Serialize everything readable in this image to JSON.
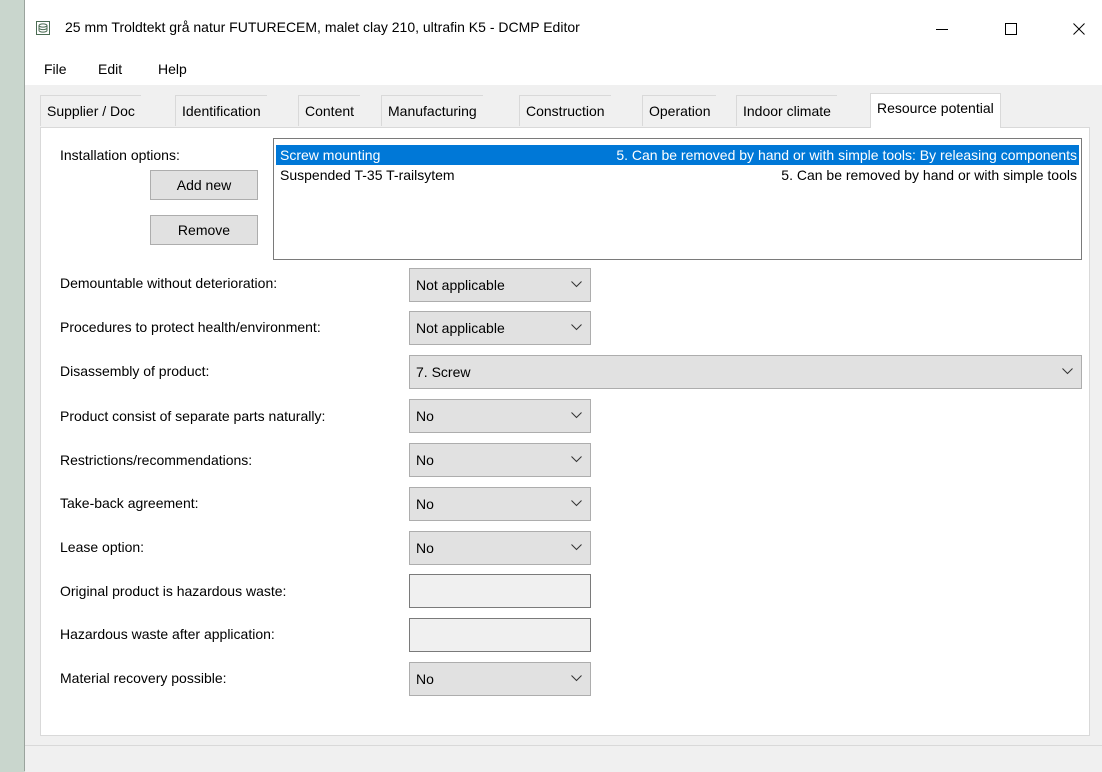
{
  "window": {
    "title": "25 mm Troldtekt grå natur FUTURECEM, malet clay  210, ultrafin K5 - DCMP Editor",
    "app_icon": "db-icon"
  },
  "menu": [
    "File",
    "Edit",
    "Help"
  ],
  "tabs": [
    {
      "label": "Supplier / Doc",
      "active": false
    },
    {
      "label": "Identification",
      "active": false
    },
    {
      "label": "Content",
      "active": false
    },
    {
      "label": "Manufacturing",
      "active": false
    },
    {
      "label": "Construction",
      "active": false
    },
    {
      "label": "Operation",
      "active": false
    },
    {
      "label": "Indoor climate",
      "active": false
    },
    {
      "label": "Resource potential",
      "active": true
    }
  ],
  "installation": {
    "label": "Installation options:",
    "add_button": "Add new",
    "remove_button": "Remove",
    "items": [
      {
        "name": "Screw mounting",
        "value": "5. Can be removed by hand or with simple tools: By releasing components",
        "selected": true
      },
      {
        "name": "Suspended T-35 T-railsytem",
        "value": "5. Can be removed by hand or with simple tools",
        "selected": false
      }
    ]
  },
  "fields": {
    "demountable": {
      "label": "Demountable without deterioration:",
      "value": "Not applicable"
    },
    "procedures": {
      "label": "Procedures to protect health/environment:",
      "value": "Not applicable"
    },
    "disassembly": {
      "label": "Disassembly of product:",
      "value": "7. Screw"
    },
    "separate_parts": {
      "label": "Product consist of separate parts naturally:",
      "value": "No"
    },
    "restrictions": {
      "label": "Restrictions/recommendations:",
      "value": "No"
    },
    "take_back": {
      "label": "Take-back agreement:",
      "value": "No"
    },
    "lease": {
      "label": "Lease option:",
      "value": "No"
    },
    "hazardous_original": {
      "label": "Original product is hazardous waste:",
      "value": ""
    },
    "hazardous_after": {
      "label": "Hazardous waste after application:",
      "value": ""
    },
    "material_recovery": {
      "label": "Material recovery possible:",
      "value": "No"
    }
  },
  "colors": {
    "selection": "#0078d7",
    "panel": "#ffffff",
    "chrome": "#f0f0f0"
  }
}
